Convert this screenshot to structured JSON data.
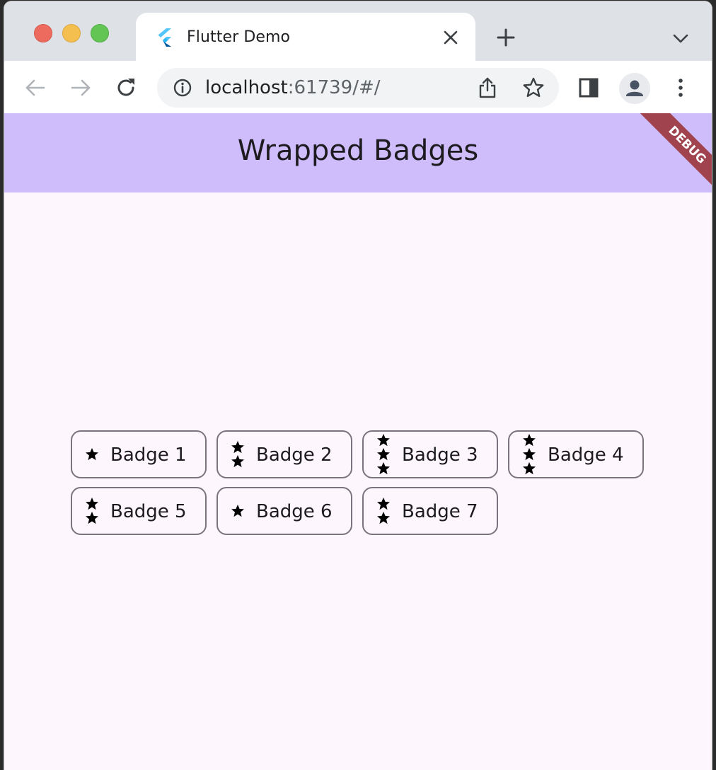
{
  "browser": {
    "tab": {
      "title": "Flutter Demo",
      "close_icon": "close-icon",
      "favicon": "flutter-logo-icon"
    },
    "new_tab_icon": "plus-icon",
    "tab_search_icon": "chevron-down-icon",
    "toolbar": {
      "back_icon": "arrow-left-icon",
      "forward_icon": "arrow-right-icon",
      "reload_icon": "reload-icon",
      "site_info_icon": "info-icon",
      "url_host": "localhost",
      "url_rest": ":61739/#/",
      "share_icon": "share-icon",
      "bookmark_icon": "star-outline-icon",
      "side_panel_icon": "side-panel-icon",
      "profile_icon": "person-icon",
      "menu_icon": "kebab-menu-icon"
    },
    "window_controls": {
      "close_color": "#ed6a5e",
      "minimize_color": "#f5bf4f",
      "zoom_color": "#62c554"
    }
  },
  "app": {
    "title": "Wrapped Badges",
    "appbar_color": "#cfbdfb",
    "background_color": "#fdf7fd",
    "debug_banner": "DEBUG",
    "badges": [
      {
        "label": "Badge 1",
        "stars": 1
      },
      {
        "label": "Badge 2",
        "stars": 2
      },
      {
        "label": "Badge 3",
        "stars": 3
      },
      {
        "label": "Badge 4",
        "stars": 3
      },
      {
        "label": "Badge 5",
        "stars": 2
      },
      {
        "label": "Badge 6",
        "stars": 1
      },
      {
        "label": "Badge 7",
        "stars": 2
      }
    ]
  }
}
